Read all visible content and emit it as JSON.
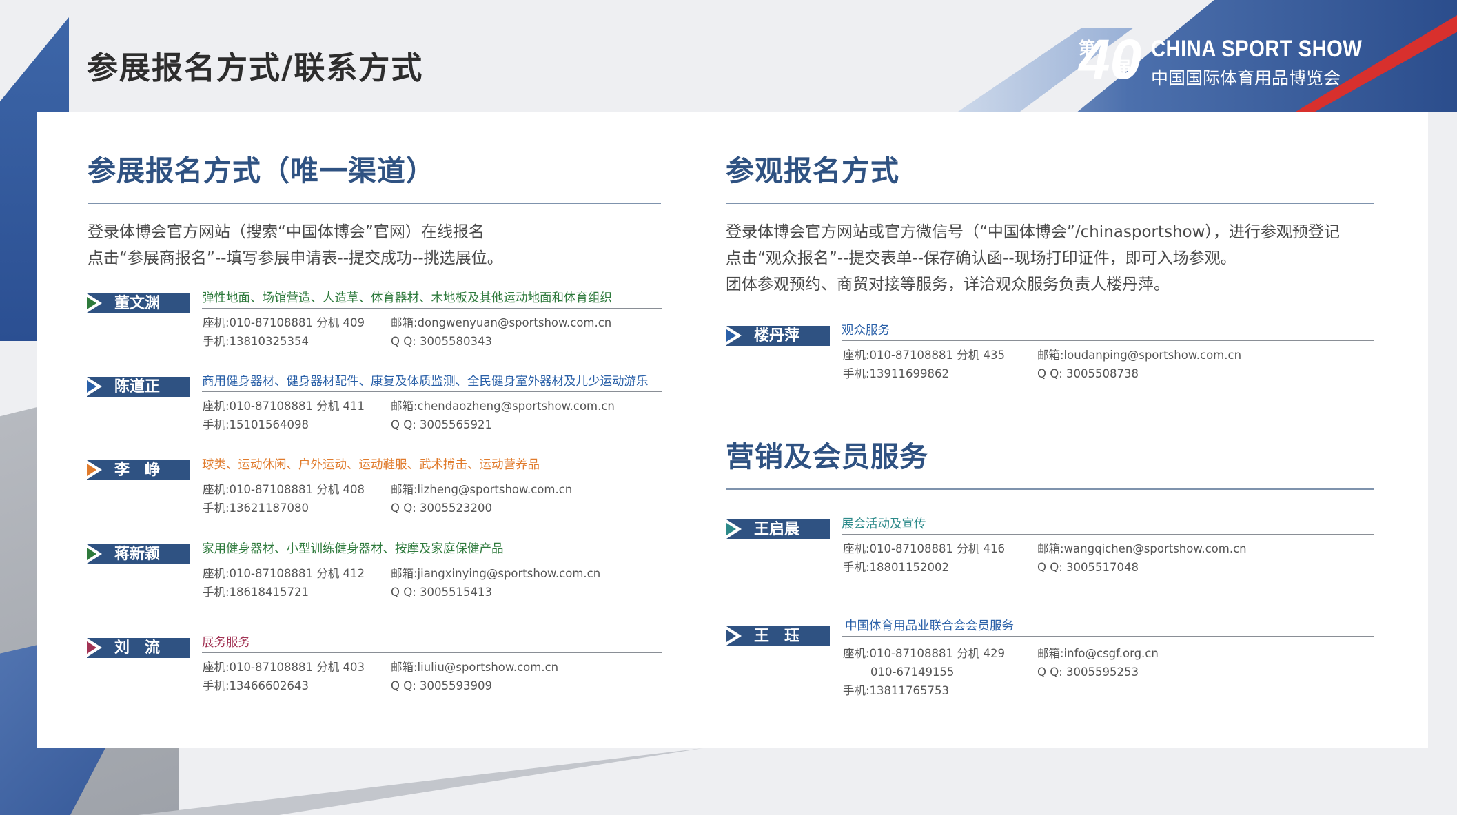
{
  "page": {
    "title": "参展报名方式/联系方式"
  },
  "logo": {
    "number": "40",
    "char_di": "第",
    "char_jie": "届",
    "name_en": "CHINA SPORT SHOW",
    "name_cn": "中国国际体育用品博览会"
  },
  "colors": {
    "navy": "#2f5282",
    "green": "#2e7a3c",
    "blue": "#2a60a8",
    "orange": "#e07b2c",
    "maroon": "#a23354",
    "teal": "#2d8a8a"
  },
  "exhibit": {
    "title": "参展报名方式（唯一渠道）",
    "lines": [
      "登录体博会官方网站（搜索“中国体博会”官网）在线报名",
      "点击“参展商报名”--填写参展申请表--提交成功--挑选展位。"
    ],
    "contacts": [
      {
        "name": "董文渊",
        "category": "弹性地面、场馆营造、人造草、体育器材、木地板及其他运动地面和体育组织",
        "phone": "座机:010-87108881 分机 409",
        "mobile": "手机:13810325354",
        "email": "邮箱:dongwenyuan@sportshow.com.cn",
        "qq": "Q Q:  3005580343"
      },
      {
        "name": "陈道正",
        "category": "商用健身器材、健身器材配件、康复及体质监测、全民健身室外器材及儿少运动游乐",
        "phone": "座机:010-87108881 分机 411",
        "mobile": "手机:15101564098",
        "email": "邮箱:chendaozheng@sportshow.com.cn",
        "qq": "Q Q:  3005565921"
      },
      {
        "name": "李　峥",
        "category": "球类、运动休闲、户外运动、运动鞋服、武术搏击、运动营养品",
        "phone": "座机:010-87108881 分机 408",
        "mobile": "手机:13621187080",
        "email": "邮箱:lizheng@sportshow.com.cn",
        "qq": "Q Q:  3005523200"
      },
      {
        "name": "蒋新颖",
        "category": "家用健身器材、小型训练健身器材、按摩及家庭保健产品",
        "phone": "座机:010-87108881 分机 412",
        "mobile": "手机:18618415721",
        "email": "邮箱:jiangxinying@sportshow.com.cn",
        "qq": "Q Q:  3005515413"
      },
      {
        "name": "刘　流",
        "category": "展务服务",
        "phone": "座机:010-87108881 分机 403",
        "mobile": "手机:13466602643",
        "email": "邮箱:liuliu@sportshow.com.cn",
        "qq": "Q Q:  3005593909"
      }
    ]
  },
  "visitor": {
    "title": "参观报名方式",
    "lines": [
      "登录体博会官方网站或官方微信号（“中国体博会”/chinasportshow），进行参观预登记",
      "点击“观众报名”--提交表单--保存确认函--现场打印证件，即可入场参观。",
      "团体参观预约、商贸对接等服务，详洽观众服务负责人楼丹萍。"
    ],
    "contact": {
      "name": "楼丹萍",
      "category": "观众服务",
      "phone": "座机:010-87108881 分机 435",
      "mobile": "手机:13911699862",
      "email": "邮箱:loudanping@sportshow.com.cn",
      "qq": "Q Q:  3005508738"
    }
  },
  "marketing": {
    "title": "营销及会员服务",
    "contacts": [
      {
        "name": "王启晨",
        "category": "展会活动及宣传",
        "phone": "座机:010-87108881 分机 416",
        "mobile": "手机:18801152002",
        "email": "邮箱:wangqichen@sportshow.com.cn",
        "qq": "Q Q:  3005517048"
      },
      {
        "name": "王　珏",
        "category": "中国体育用品业联合会会员服务",
        "phone": "座机:010-87108881 分机 429",
        "phone2": "010-67149155",
        "mobile": "手机:13811765753",
        "email": "邮箱:info@csgf.org.cn",
        "qq": "Q Q:  3005595253"
      }
    ]
  }
}
